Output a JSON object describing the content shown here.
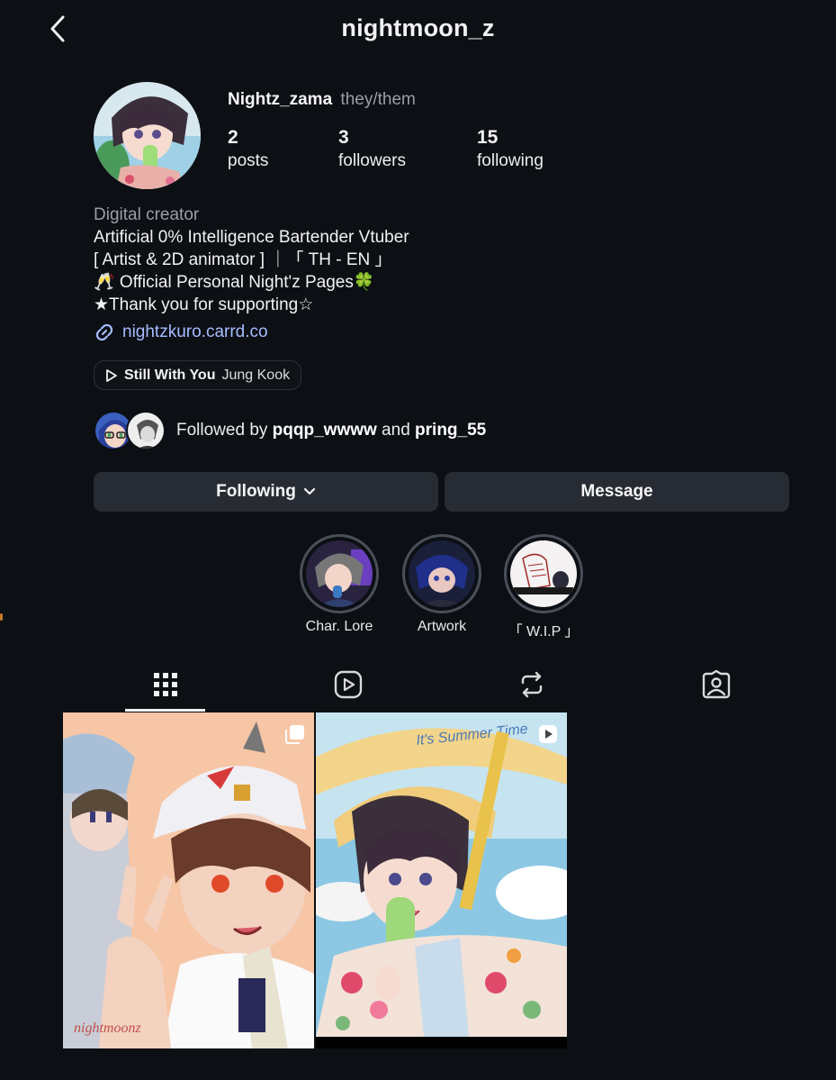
{
  "header": {
    "title": "nightmoon_z",
    "back_icon": "chevron-left-icon"
  },
  "profile": {
    "display_name": "Nightz_zama",
    "pronouns": "they/them",
    "stats": [
      {
        "value": "2",
        "label": "posts"
      },
      {
        "value": "3",
        "label": "followers"
      },
      {
        "value": "15",
        "label": "following"
      }
    ],
    "category": "Digital creator",
    "bio_lines": [
      "Artificial 0% Intelligence Bartender Vtuber",
      "[ Artist & 2D animator ] ｜「 TH - EN 」",
      "🥂 Official Personal Night'z Pages🍀",
      "★Thank you for supporting☆"
    ],
    "link": "nightzkuro.carrd.co",
    "link_icon": "link-icon"
  },
  "music": {
    "song": "Still With You",
    "artist": "Jung Kook",
    "icon": "play-icon"
  },
  "followed_by": {
    "prefix": "Followed by ",
    "user1": "pqqp_wwww",
    "conj": " and ",
    "user2": "pring_55"
  },
  "actions": {
    "following_label": "Following",
    "message_label": "Message"
  },
  "highlights": [
    {
      "label": "Char. Lore"
    },
    {
      "label": "Artwork"
    },
    {
      "label": "「 W.I.P 」"
    }
  ],
  "tabs": [
    {
      "name": "grid",
      "icon": "grid-icon",
      "active": true
    },
    {
      "name": "reels",
      "icon": "reels-icon",
      "active": false
    },
    {
      "name": "reposts",
      "icon": "repost-icon",
      "active": false
    },
    {
      "name": "tagged",
      "icon": "tagged-icon",
      "active": false
    }
  ],
  "posts": [
    {
      "type": "carousel",
      "badge_icon": "carousel-icon",
      "signature": "nightmoonz"
    },
    {
      "type": "reel",
      "badge_icon": "reel-icon",
      "caption_art": "It's Summer Time"
    }
  ],
  "colors": {
    "background": "#0c0f14",
    "button": "#272b33",
    "link": "#a6bcff",
    "muted": "#9a9ea6"
  }
}
